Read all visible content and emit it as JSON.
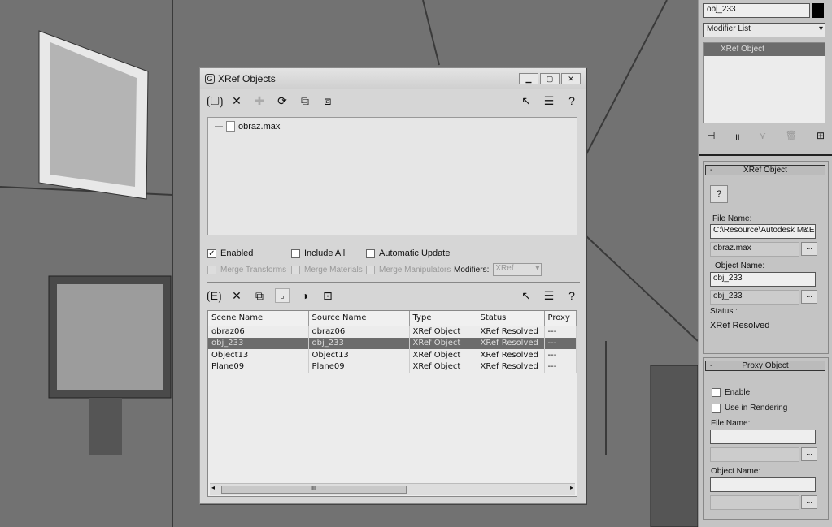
{
  "dialog": {
    "title": "XRef Objects",
    "file": "obraz.max",
    "options": {
      "enabled": "Enabled",
      "include_all": "Include All",
      "auto_update": "Automatic Update",
      "merge_transforms": "Merge Transforms",
      "merge_materials": "Merge Materials",
      "merge_manipulators": "Merge Manipulators",
      "modifiers_label": "Modifiers:",
      "modifiers_value": "XRef"
    },
    "columns": [
      "Scene Name",
      "Source Name",
      "Type",
      "Status",
      "Proxy"
    ],
    "rows": [
      [
        "obraz06",
        "obraz06",
        "XRef Object",
        "XRef Resolved",
        "---"
      ],
      [
        "obj_233",
        "obj_233",
        "XRef Object",
        "XRef Resolved",
        "---"
      ],
      [
        "Object13",
        "Object13",
        "XRef Object",
        "XRef Resolved",
        "---"
      ],
      [
        "Plane09",
        "Plane09",
        "XRef Object",
        "XRef Resolved",
        "---"
      ]
    ],
    "scroll_grip": "III"
  },
  "panel": {
    "object_name": "obj_233",
    "modifier_list": "Modifier List",
    "stack_item": "XRef Object",
    "xref": {
      "header": "XRef Object",
      "collapse": "-",
      "file_name_label": "File Name:",
      "file_path": "C:\\Resource\\Autodesk M&E'",
      "file_value": "obraz.max",
      "object_name_label": "Object Name:",
      "object_name": "obj_233",
      "object_value": "obj_233",
      "status_label": "Status :",
      "status": "XRef Resolved",
      "browse": "..."
    },
    "proxy": {
      "header": "Proxy Object",
      "collapse": "-",
      "enable": "Enable",
      "use_in_rendering": "Use in Rendering",
      "file_name_label": "File Name:",
      "object_name_label": "Object Name:",
      "browse": "..."
    }
  }
}
